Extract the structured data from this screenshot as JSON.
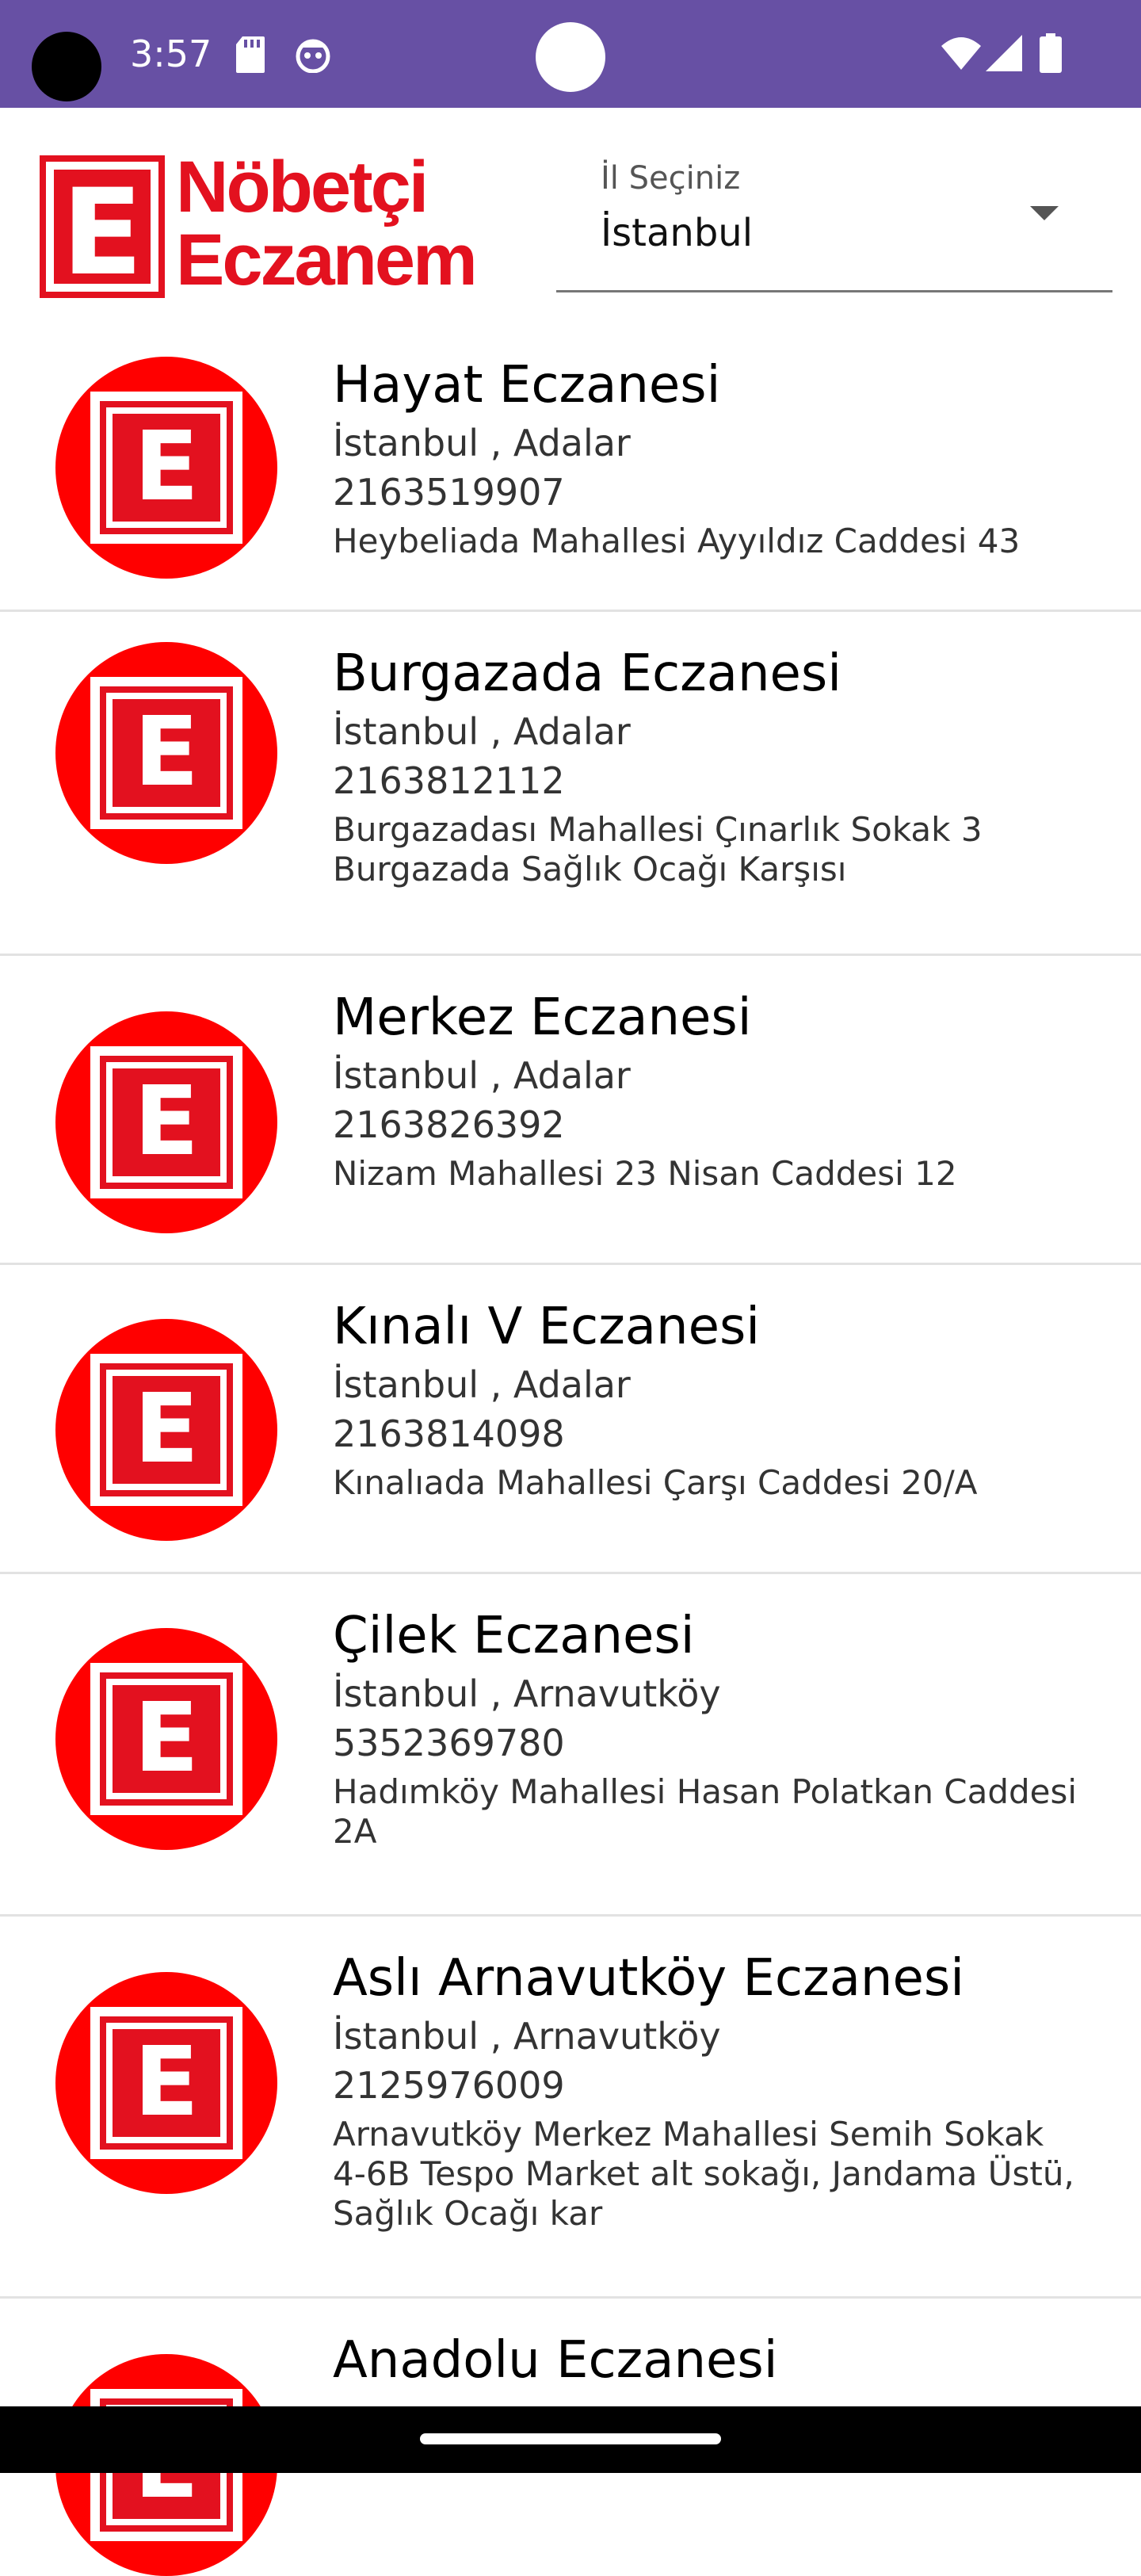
{
  "status_bar": {
    "time": "3:57",
    "bg_color": "#6750a4",
    "icons": [
      "sd-card-icon",
      "face-icon",
      "wifi-icon",
      "signal-icon",
      "battery-icon"
    ]
  },
  "header": {
    "logo_letter": "E",
    "logo_line1": "Nöbetçi",
    "logo_line2": "Eczanem",
    "logo_color": "#e3111f",
    "city_select": {
      "label": "İl Seçiniz",
      "value": "İstanbul"
    }
  },
  "pharmacies": [
    {
      "name": "Hayat Eczanesi",
      "location": "İstanbul , Adalar",
      "phone": "2163519907",
      "address": [
        "Heybeliada Mahallesi Ayyıldız Caddesi 43"
      ]
    },
    {
      "name": "Burgazada Eczanesi",
      "location": "İstanbul , Adalar",
      "phone": "2163812112",
      "address": [
        "Burgazadası Mahallesi Çınarlık Sokak 3",
        "Burgazada Sağlık Ocağı Karşısı"
      ]
    },
    {
      "name": "Merkez Eczanesi",
      "location": "İstanbul , Adalar",
      "phone": "2163826392",
      "address": [
        "Nizam Mahallesi 23 Nisan Caddesi 12"
      ]
    },
    {
      "name": "Kınalı V Eczanesi",
      "location": "İstanbul , Adalar",
      "phone": "2163814098",
      "address": [
        "Kınalıada Mahallesi Çarşı Caddesi 20/A"
      ]
    },
    {
      "name": "Çilek Eczanesi",
      "location": "İstanbul , Arnavutköy",
      "phone": "5352369780",
      "address": [
        "Hadımköy Mahallesi Hasan Polatkan Caddesi",
        "2A"
      ]
    },
    {
      "name": "Aslı Arnavutköy Eczanesi",
      "location": "İstanbul , Arnavutköy",
      "phone": "2125976009",
      "address": [
        "Arnavutköy Merkez Mahallesi Semih Sokak",
        "4-6B Tespo Market alt sokağı, Jandama Üstü,",
        "Sağlık Ocağı kar"
      ]
    },
    {
      "name": "Anadolu Eczanesi",
      "location": "",
      "phone": "",
      "address": []
    }
  ],
  "icon_letter": "E"
}
